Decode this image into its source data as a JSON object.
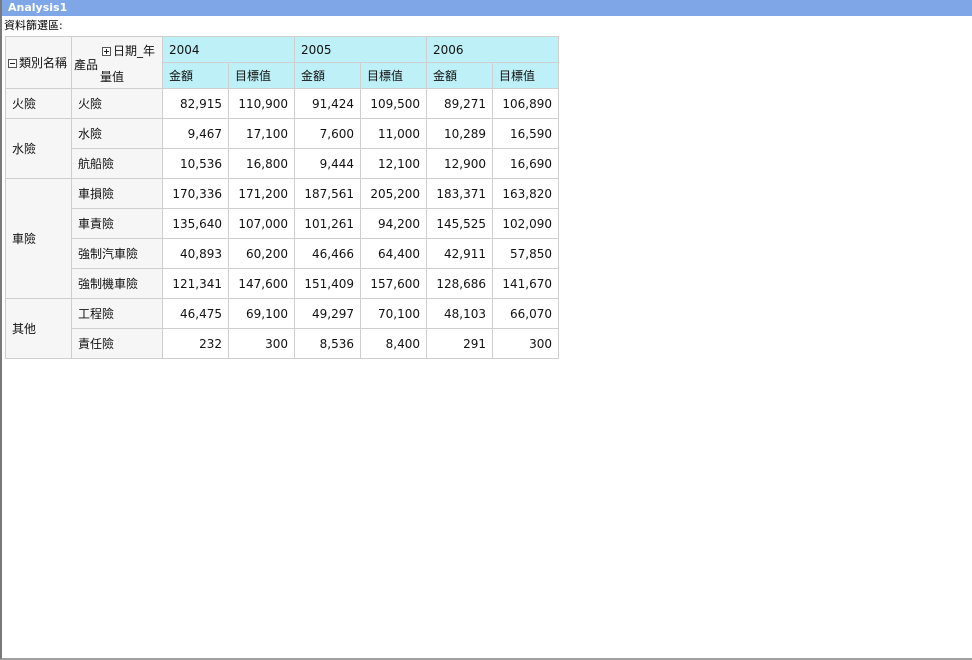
{
  "window": {
    "title": "Analysis1"
  },
  "filter_area": {
    "label": "資料篩選區:"
  },
  "pivot": {
    "row_field_1": "類別名稱",
    "row_field_2": "產品",
    "column_field": "日期_年",
    "measure_field": "量值",
    "years": [
      "2004",
      "2005",
      "2006"
    ],
    "measures": [
      "金額",
      "目標值"
    ],
    "categories": [
      {
        "name": "火險",
        "products": [
          {
            "name": "火險",
            "values": [
              "82,915",
              "110,900",
              "91,424",
              "109,500",
              "89,271",
              "106,890"
            ]
          }
        ]
      },
      {
        "name": "水險",
        "products": [
          {
            "name": "水險",
            "values": [
              "9,467",
              "17,100",
              "7,600",
              "11,000",
              "10,289",
              "16,590"
            ]
          },
          {
            "name": "航船險",
            "values": [
              "10,536",
              "16,800",
              "9,444",
              "12,100",
              "12,900",
              "16,690"
            ]
          }
        ]
      },
      {
        "name": "車險",
        "products": [
          {
            "name": "車損險",
            "values": [
              "170,336",
              "171,200",
              "187,561",
              "205,200",
              "183,371",
              "163,820"
            ]
          },
          {
            "name": "車責險",
            "values": [
              "135,640",
              "107,000",
              "101,261",
              "94,200",
              "145,525",
              "102,090"
            ]
          },
          {
            "name": "強制汽車險",
            "values": [
              "40,893",
              "60,200",
              "46,466",
              "64,400",
              "42,911",
              "57,850"
            ]
          },
          {
            "name": "強制機車險",
            "values": [
              "121,341",
              "147,600",
              "151,409",
              "157,600",
              "128,686",
              "141,670"
            ]
          }
        ]
      },
      {
        "name": "其他",
        "products": [
          {
            "name": "工程險",
            "values": [
              "46,475",
              "69,100",
              "49,297",
              "70,100",
              "48,103",
              "66,070"
            ]
          },
          {
            "name": "責任險",
            "values": [
              "232",
              "300",
              "8,536",
              "8,400",
              "291",
              "300"
            ]
          }
        ]
      }
    ]
  }
}
